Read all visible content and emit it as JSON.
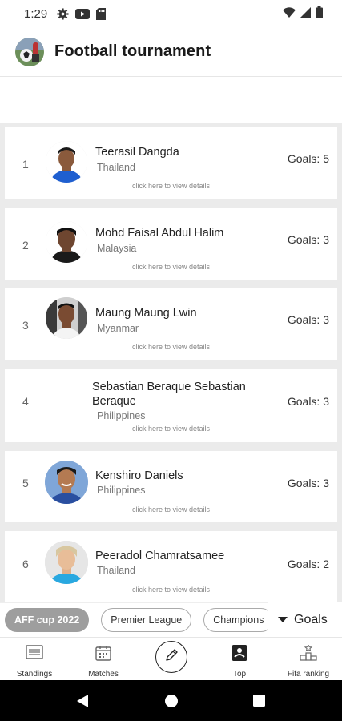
{
  "status": {
    "time": "1:29"
  },
  "app": {
    "title": "Football tournament"
  },
  "players": [
    {
      "rank": "1",
      "name": "Teerasil Dangda",
      "country": "Thailand",
      "goals": "Goals: 5",
      "hint": "click here to view details",
      "avatar": "avatar-1"
    },
    {
      "rank": "2",
      "name": "Mohd Faisal Abdul Halim",
      "country": "Malaysia",
      "goals": "Goals: 3",
      "hint": "click here to view details",
      "avatar": "avatar-2"
    },
    {
      "rank": "3",
      "name": "Maung Maung Lwin",
      "country": "Myanmar",
      "goals": "Goals: 3",
      "hint": "click here to view details",
      "avatar": "avatar-3"
    },
    {
      "rank": "4",
      "name": "Sebastian Beraque Sebastian Beraque",
      "country": "Philippines",
      "goals": "Goals: 3",
      "hint": "click here to view details",
      "avatar": ""
    },
    {
      "rank": "5",
      "name": "Kenshiro Daniels",
      "country": "Philippines",
      "goals": "Goals: 3",
      "hint": "click here to view details",
      "avatar": "avatar-5"
    },
    {
      "rank": "6",
      "name": "Peeradol Chamratsamee",
      "country": "Thailand",
      "goals": "Goals: 2",
      "hint": "click here to view details",
      "avatar": "avatar-6"
    }
  ],
  "chips": [
    "AFF cup 2022",
    "Premier League",
    "Champions"
  ],
  "sort": {
    "label": "Goals"
  },
  "nav": {
    "standings": "Standings",
    "matches": "Matches",
    "top": "Top",
    "fifa": "Fifa ranking"
  },
  "colors": {
    "chip_active": "#9e9e9e",
    "list_bg": "#ebebeb"
  }
}
